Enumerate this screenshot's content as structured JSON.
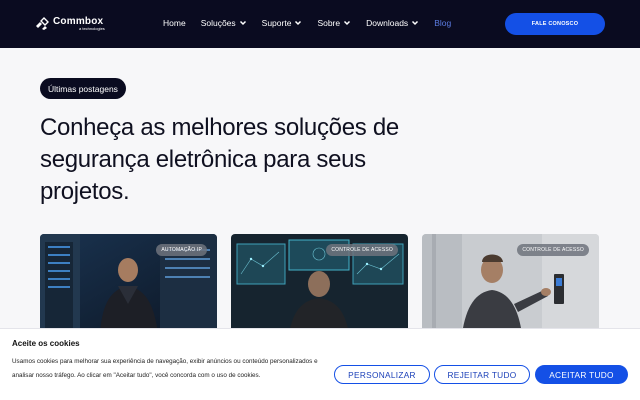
{
  "header": {
    "logo_text": "Commbox",
    "logo_sub": "a technologies",
    "nav": [
      {
        "label": "Home",
        "dropdown": false
      },
      {
        "label": "Soluções",
        "dropdown": true
      },
      {
        "label": "Suporte",
        "dropdown": true
      },
      {
        "label": "Sobre",
        "dropdown": true
      },
      {
        "label": "Downloads",
        "dropdown": true
      },
      {
        "label": "Blog",
        "dropdown": false,
        "active": true
      }
    ],
    "cta_label": "FALE CONOSCO"
  },
  "hero": {
    "pill": "Últimas postagens",
    "headline": "Conheça as melhores soluções de segurança eletrônica para seus projetos."
  },
  "cards": [
    {
      "tag": "AUTOMAÇÃO IP"
    },
    {
      "tag": "CONTROLE DE ACESSO"
    },
    {
      "tag": "CONTROLE DE ACESSO"
    }
  ],
  "cookie_banner": {
    "title": "Aceite os cookies",
    "text": "Usamos cookies para melhorar sua experiência de navegação, exibir anúncios ou conteúdo personalizados e analisar nosso tráfego. Ao clicar em \"Aceitar tudo\", você concorda com o uso de cookies.",
    "customize_label": "PERSONALIZAR",
    "reject_label": "REJEITAR TUDO",
    "accept_label": "ACEITAR TUDO"
  },
  "colors": {
    "header_bg": "#0a0b20",
    "accent": "#1450e6",
    "blog_link": "#5b7be0"
  }
}
